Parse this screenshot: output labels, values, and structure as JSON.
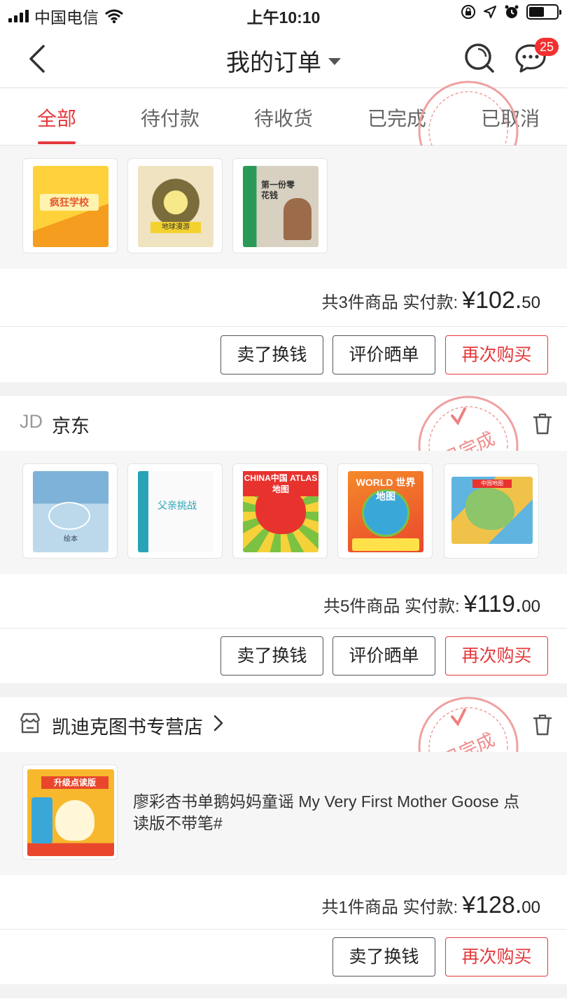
{
  "status_bar": {
    "carrier": "中国电信",
    "time": "上午10:10"
  },
  "nav": {
    "title": "我的订单",
    "message_badge": "25"
  },
  "tabs": [
    {
      "label": "全部",
      "active": true
    },
    {
      "label": "待付款",
      "active": false
    },
    {
      "label": "待收货",
      "active": false
    },
    {
      "label": "已完成",
      "active": false
    },
    {
      "label": "已取消",
      "active": false
    }
  ],
  "orders": [
    {
      "summary_text": "共3件商品  实付款:",
      "price_int": "¥102.",
      "price_cents": "50",
      "buttons": [
        "卖了换钱",
        "评价晒单",
        "再次购买"
      ],
      "thumbs": [
        "疯狂学校",
        "地球漫游",
        "第一份零花钱"
      ]
    },
    {
      "shop_logo": "JD",
      "shop_name": "京东",
      "stamp_text": "已完成",
      "summary_text": "共5件商品  实付款:",
      "price_int": "¥119.",
      "price_cents": "00",
      "buttons": [
        "卖了换钱",
        "评价晒单",
        "再次购买"
      ],
      "thumbs": [
        "绘本",
        "父亲挑战",
        "CHINA中国 ATLAS地图",
        "WORLD 世界地图",
        "中国地图"
      ]
    },
    {
      "shop_name": "凯迪克图书专营店",
      "stamp_text": "已完成",
      "product_title": "廖彩杏书单鹅妈妈童谣 My Very First Mother Goose 点读版不带笔#",
      "summary_text": "共1件商品  实付款:",
      "price_int": "¥128.",
      "price_cents": "00",
      "buttons": [
        "卖了换钱",
        "再次购买"
      ],
      "thumbs": [
        "升级点读版"
      ]
    }
  ]
}
